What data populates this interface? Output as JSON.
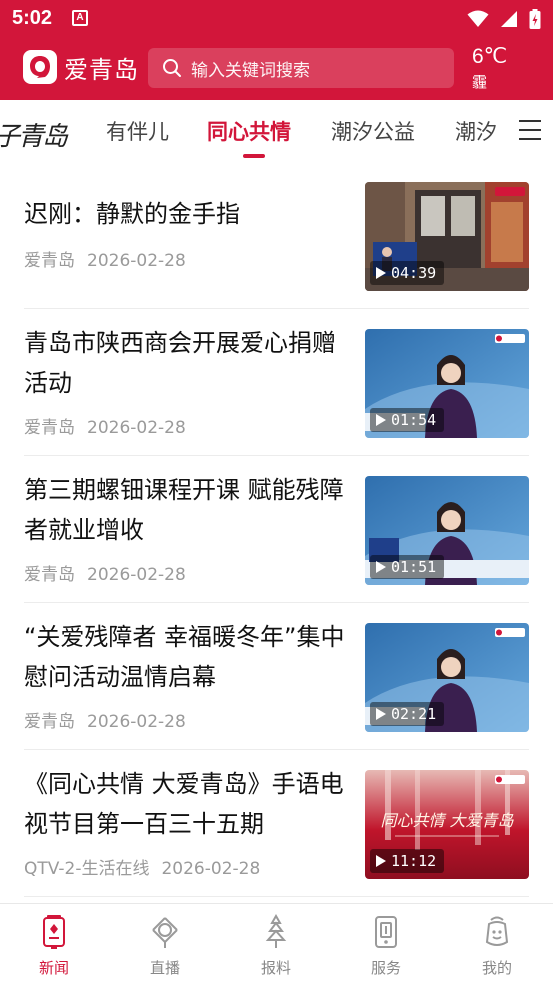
{
  "status_bar": {
    "time": "5:02",
    "notification_icon": "A"
  },
  "header": {
    "app_name": "爱青岛",
    "search_placeholder": "输入关键词搜索",
    "weather": {
      "temperature": "6℃",
      "condition": "霾"
    }
  },
  "tabs": {
    "partial_logo": "子青岛",
    "items": [
      {
        "label": "有伴儿"
      },
      {
        "label": "同心共情",
        "active": true
      },
      {
        "label": "潮汐公益"
      },
      {
        "label": "潮汐"
      }
    ]
  },
  "news": [
    {
      "title": "迟刚：静默的金手指",
      "source": "爱青岛",
      "date": "2026-02-28",
      "duration": "04:39"
    },
    {
      "title": "青岛市陕西商会开展爱心捐赠活动",
      "source": "爱青岛",
      "date": "2026-02-28",
      "duration": "01:54"
    },
    {
      "title": "第三期螺钿课程开课  赋能残障者就业增收",
      "source": "爱青岛",
      "date": "2026-02-28",
      "duration": "01:51"
    },
    {
      "title": "“关爱残障者  幸福暖冬年”集中慰问活动温情启幕",
      "source": "爱青岛",
      "date": "2026-02-28",
      "duration": "02:21"
    },
    {
      "title": "《同心共情  大爱青岛》手语电视节目第一百三十五期",
      "source": "QTV-2-生活在线",
      "date": "2026-02-28",
      "duration": "11:12"
    }
  ],
  "thumbnail_overlays": {
    "brand_badge": "爱青岛",
    "show_title": "同心共情 大爱青岛"
  },
  "bottom_nav": [
    {
      "label": "新闻",
      "icon": "news-icon",
      "active": true
    },
    {
      "label": "直播",
      "icon": "live-icon"
    },
    {
      "label": "报料",
      "icon": "report-icon"
    },
    {
      "label": "服务",
      "icon": "service-icon"
    },
    {
      "label": "我的",
      "icon": "profile-icon"
    }
  ],
  "colors": {
    "brand": "#d2163a",
    "meta_text": "#9a9a9a",
    "nav_inactive": "#888888"
  }
}
